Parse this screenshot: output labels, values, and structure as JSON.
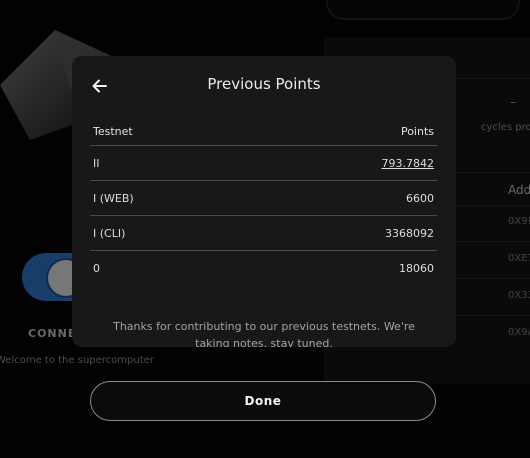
{
  "background": {
    "status_dash": "–",
    "cycles_text": "cycles prov",
    "address_header": "Add",
    "addresses": [
      "0X9!",
      "0XE7",
      "0X33",
      "0X9A"
    ],
    "connect_label": "CONNEC",
    "welcome_text": "Welcome to the supercomputer"
  },
  "modal": {
    "title": "Previous Points",
    "columns": {
      "testnet": "Testnet",
      "points": "Points"
    },
    "rows": [
      {
        "testnet": "II",
        "points": "793.7842"
      },
      {
        "testnet": "I (WEB)",
        "points": "6600"
      },
      {
        "testnet": "I (CLI)",
        "points": "3368092"
      },
      {
        "testnet": "0",
        "points": "18060"
      }
    ],
    "thanks_text": "Thanks for contributing to our previous testnets. We're taking notes, stay tuned."
  },
  "actions": {
    "done_label": "Done"
  },
  "colors": {
    "modal_bg": "#181818",
    "page_bg": "#050505",
    "toggle_blue": "#2e6fc0"
  },
  "icons": {
    "back": "arrow-left-icon",
    "power": "power-icon"
  }
}
